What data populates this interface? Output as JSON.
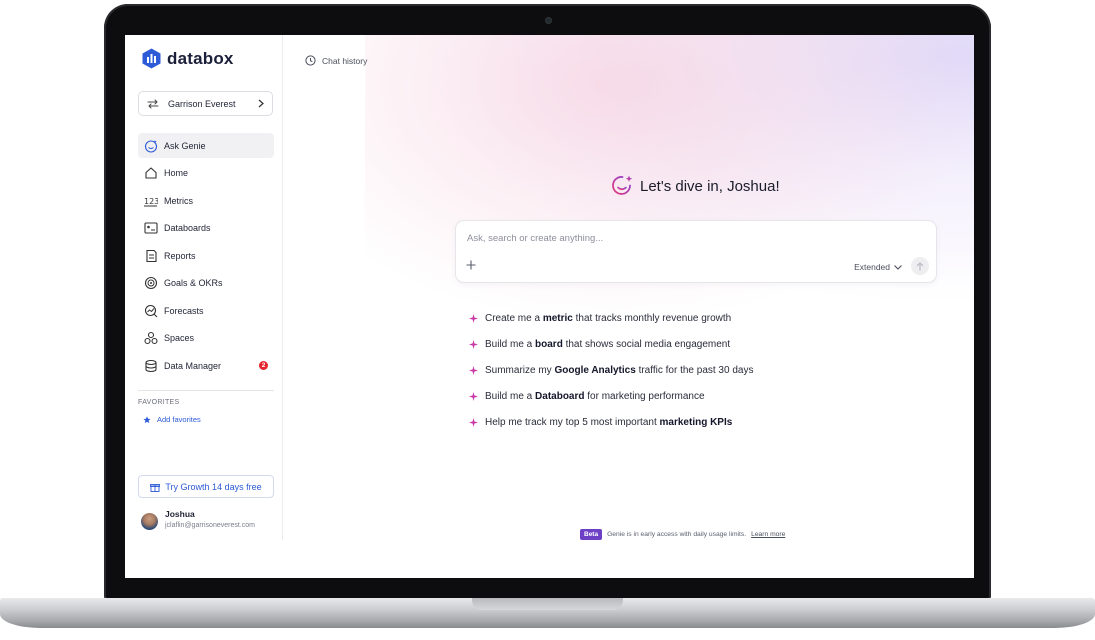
{
  "brand": {
    "name": "databox",
    "color": "#2d5bd7"
  },
  "workspace": {
    "name": "Garrison Everest"
  },
  "nav": [
    {
      "label": "Ask Genie",
      "icon": "genie-icon",
      "active": true
    },
    {
      "label": "Home",
      "icon": "home-icon"
    },
    {
      "label": "Metrics",
      "icon": "metrics-icon"
    },
    {
      "label": "Databoards",
      "icon": "databoards-icon"
    },
    {
      "label": "Reports",
      "icon": "reports-icon"
    },
    {
      "label": "Goals & OKRs",
      "icon": "target-icon"
    },
    {
      "label": "Forecasts",
      "icon": "forecast-icon"
    },
    {
      "label": "Spaces",
      "icon": "spaces-icon"
    },
    {
      "label": "Data Manager",
      "icon": "database-icon",
      "badge": "2"
    }
  ],
  "favorites": {
    "heading": "FAVORITES",
    "add_label": "Add favorites"
  },
  "trial": {
    "label": "Try Growth 14 days free"
  },
  "user": {
    "name": "Joshua",
    "email": "jclaflin@garrisoneverest.com"
  },
  "chat_history": {
    "label": "Chat history"
  },
  "greeting": {
    "prefix": "Let's dive in,",
    "name": "Joshua!"
  },
  "composer": {
    "placeholder": "Ask, search or create anything...",
    "mode": "Extended"
  },
  "suggestions": [
    {
      "pre": "Create me a",
      "bold": "metric",
      "post": "that tracks monthly revenue growth"
    },
    {
      "pre": "Build me a",
      "bold": "board",
      "post": "that shows social media engagement"
    },
    {
      "pre": "Summarize my",
      "bold": "Google Analytics",
      "post": "traffic for the past 30 days"
    },
    {
      "pre": "Build me a",
      "bold": "Databoard",
      "post": "for marketing performance"
    },
    {
      "pre": "Help me track my top 5 most important",
      "bold": "marketing KPIs",
      "post": ""
    }
  ],
  "footer": {
    "badge": "Beta",
    "text": "Genie is in early access with daily usage limits.",
    "link": "Learn more"
  }
}
